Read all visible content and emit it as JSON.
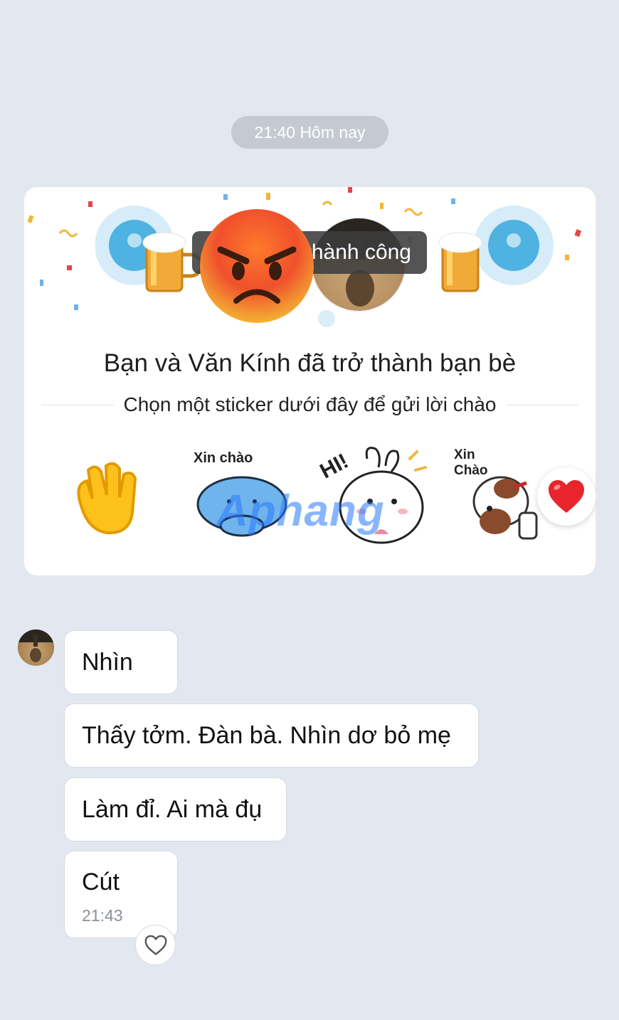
{
  "chat": {
    "time_divider": "21:40 Hôm nay"
  },
  "friend_card": {
    "toast_text": "thành công",
    "title": "Bạn và Văn Kính đã trở thành bạn bè",
    "subtitle": "Chọn một sticker dưới đây để gửi lời chào",
    "stickers": [
      {
        "name": "waving-hand",
        "caption": ""
      },
      {
        "name": "blue-cat",
        "caption": "Xin chào"
      },
      {
        "name": "bunny",
        "caption": "HI!"
      },
      {
        "name": "dog",
        "caption": "Xin Chào"
      }
    ],
    "watermark": "Aphang"
  },
  "messages": [
    {
      "text": "Nhìn"
    },
    {
      "text": "Thấy tởm. Đàn bà. Nhìn dơ bỏ mẹ"
    },
    {
      "text": "Làm đỉ. Ai mà đụ"
    },
    {
      "text": "Cút",
      "time": "21:43"
    }
  ],
  "colors": {
    "background": "#e2e7f0",
    "bubble": "#ffffff",
    "heart": "#e8242c"
  }
}
